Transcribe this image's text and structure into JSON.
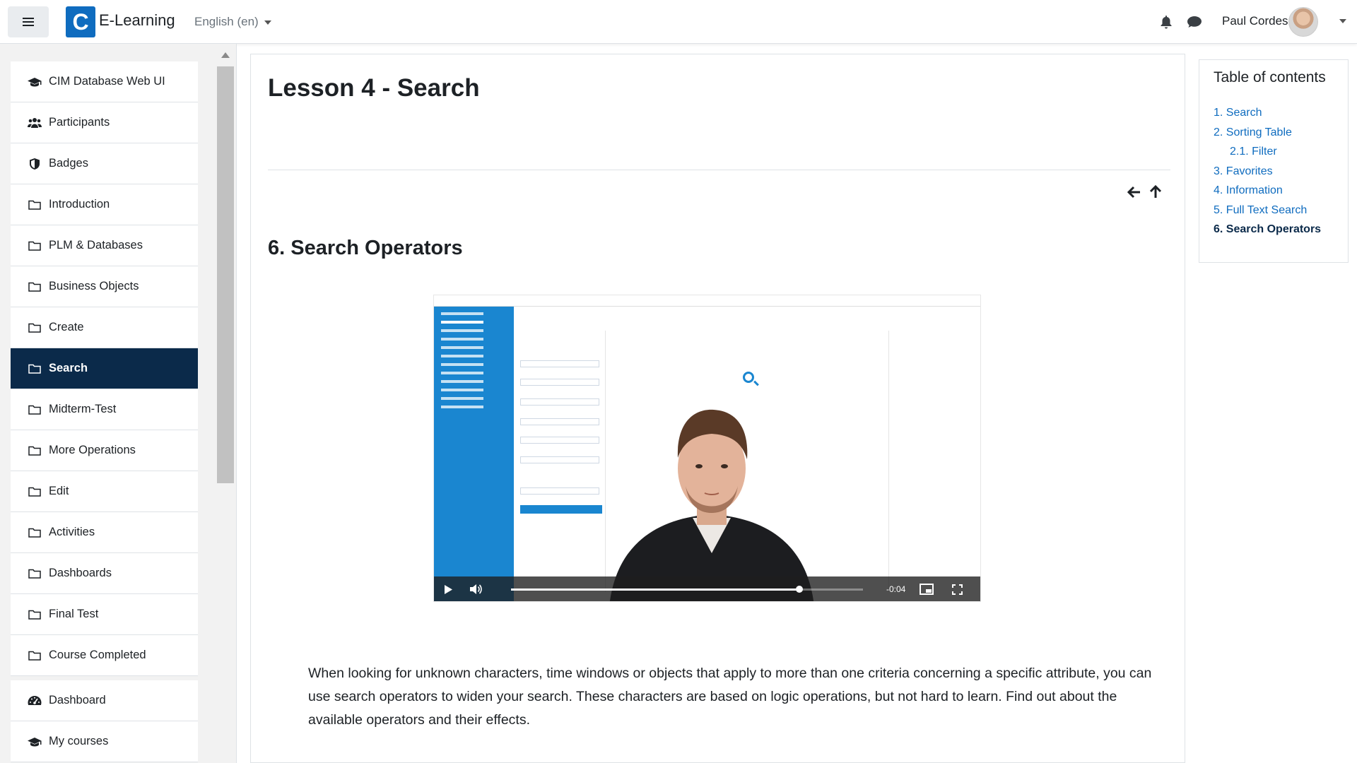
{
  "header": {
    "site_name": "E-Learning",
    "logo_letter": "C",
    "language": "English (en)",
    "user_name": "Paul Cordes"
  },
  "sidebar": {
    "items": [
      {
        "label": "CIM Database Web UI",
        "icon": "graduation-cap-icon"
      },
      {
        "label": "Participants",
        "icon": "users-icon"
      },
      {
        "label": "Badges",
        "icon": "shield-icon"
      },
      {
        "label": "Introduction",
        "icon": "folder-icon"
      },
      {
        "label": "PLM & Databases",
        "icon": "folder-icon"
      },
      {
        "label": "Business Objects",
        "icon": "folder-icon"
      },
      {
        "label": "Create",
        "icon": "folder-icon"
      },
      {
        "label": "Search",
        "icon": "folder-icon",
        "active": true
      },
      {
        "label": "Midterm-Test",
        "icon": "folder-icon"
      },
      {
        "label": "More Operations",
        "icon": "folder-icon"
      },
      {
        "label": "Edit",
        "icon": "folder-icon"
      },
      {
        "label": "Activities",
        "icon": "folder-icon"
      },
      {
        "label": "Dashboards",
        "icon": "folder-icon"
      },
      {
        "label": "Final Test",
        "icon": "folder-icon"
      },
      {
        "label": "Course Completed",
        "icon": "folder-icon"
      }
    ],
    "footer_items": [
      {
        "label": "Dashboard",
        "icon": "dashboard-icon"
      },
      {
        "label": "My courses",
        "icon": "graduation-cap-icon"
      }
    ]
  },
  "main": {
    "title": "Lesson 4 - Search",
    "section_title": "6. Search Operators",
    "video": {
      "time_remaining": "-0:04",
      "progress": 0.82
    },
    "paragraph": "When looking for unknown characters, time windows or objects that apply to more than one criteria concerning a specific attribute, you can use search operators to widen your search. These characters are based on logic operations, but not hard to learn. Find out about the available operators and their effects."
  },
  "toc": {
    "title": "Table of contents",
    "items": [
      {
        "label": "1. Search"
      },
      {
        "label": "2. Sorting Table"
      },
      {
        "label": "2.1. Filter",
        "sub": true
      },
      {
        "label": "3. Favorites"
      },
      {
        "label": "4. Information"
      },
      {
        "label": "5. Full Text Search"
      },
      {
        "label": "6. Search Operators",
        "current": true
      }
    ]
  },
  "colors": {
    "primary": "#0f6cbf",
    "active_nav": "#0b2a4a",
    "video_sidebar": "#1a86d0"
  }
}
